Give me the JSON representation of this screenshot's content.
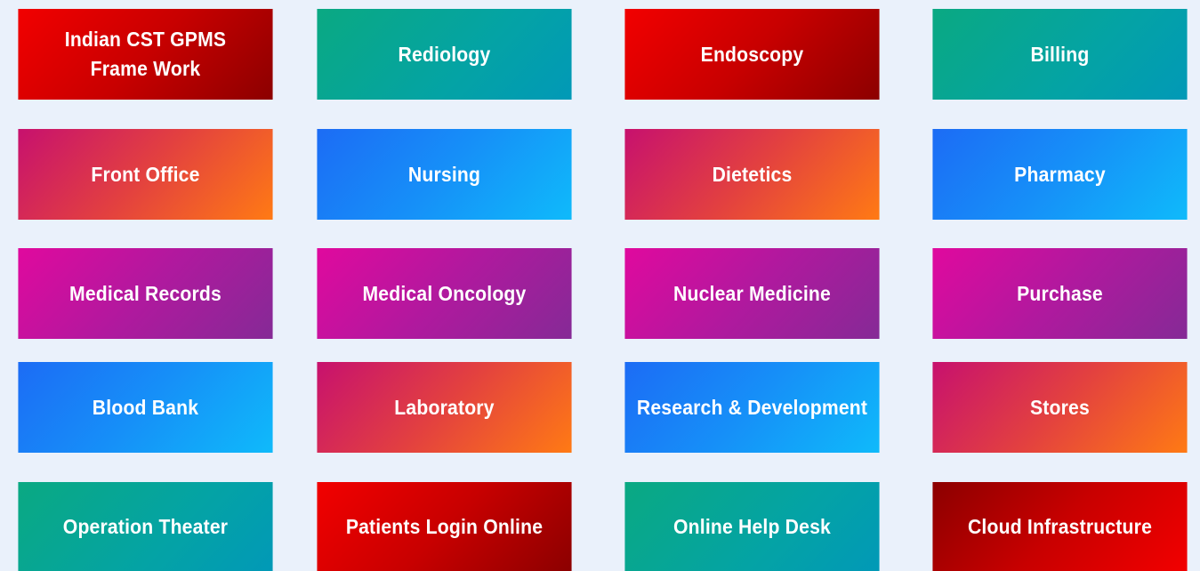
{
  "tiles": [
    {
      "label": "Indian CST GPMS Frame Work",
      "style": "red"
    },
    {
      "label": "Rediology",
      "style": "teal"
    },
    {
      "label": "Endoscopy",
      "style": "red"
    },
    {
      "label": "Billing",
      "style": "teal"
    },
    {
      "label": "Front Office",
      "style": "orange"
    },
    {
      "label": "Nursing",
      "style": "blue"
    },
    {
      "label": "Dietetics",
      "style": "orange"
    },
    {
      "label": "Pharmacy",
      "style": "blue"
    },
    {
      "label": "Medical Records",
      "style": "purple"
    },
    {
      "label": "Medical Oncology",
      "style": "purple"
    },
    {
      "label": "Nuclear Medicine",
      "style": "purple"
    },
    {
      "label": "Purchase",
      "style": "purple"
    },
    {
      "label": "Blood Bank",
      "style": "blue"
    },
    {
      "label": "Laboratory",
      "style": "orange"
    },
    {
      "label": "Research & Development",
      "style": "blue"
    },
    {
      "label": "Stores",
      "style": "orange"
    },
    {
      "label": "Operation Theater",
      "style": "teal"
    },
    {
      "label": "Patients Login Online",
      "style": "red"
    },
    {
      "label": "Online Help Desk",
      "style": "teal"
    },
    {
      "label": "Cloud Infrastructure",
      "style": "red-reverse"
    }
  ],
  "colors": {
    "page_background": "#eaf1fb",
    "red": "#f20000",
    "teal": "#04a3a5",
    "orange": "#ff7a14",
    "blue": "#1690f8",
    "purple": "#b0199e",
    "text": "#ffffff"
  }
}
